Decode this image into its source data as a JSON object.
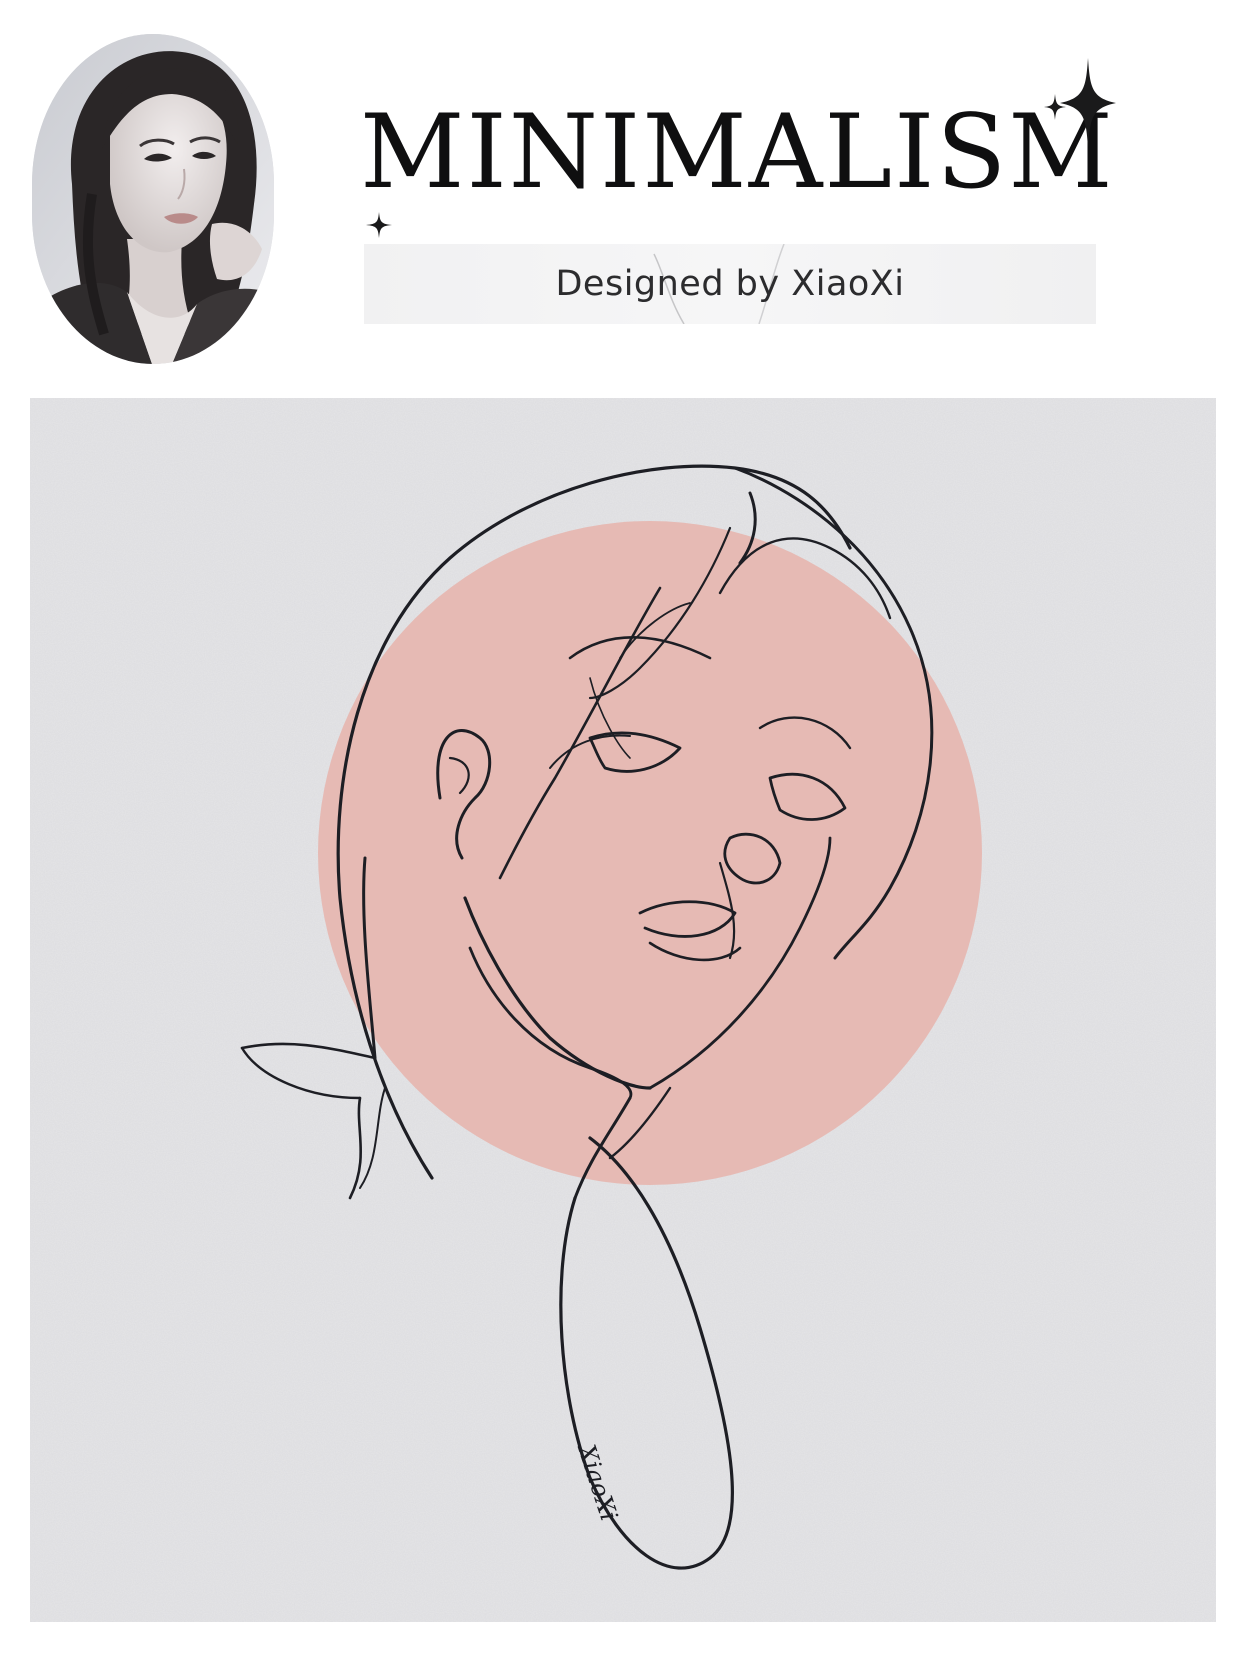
{
  "header": {
    "title": "MINIMALISM",
    "subtitle": "Designed by XiaoXi"
  },
  "artwork": {
    "signature": "XiaoXi",
    "circle_color": "#e6b6b0",
    "paper_color": "#dfdfe2",
    "ink_color": "#1d1e24"
  },
  "icons": {
    "sparkle": "four-point-star-icon"
  }
}
